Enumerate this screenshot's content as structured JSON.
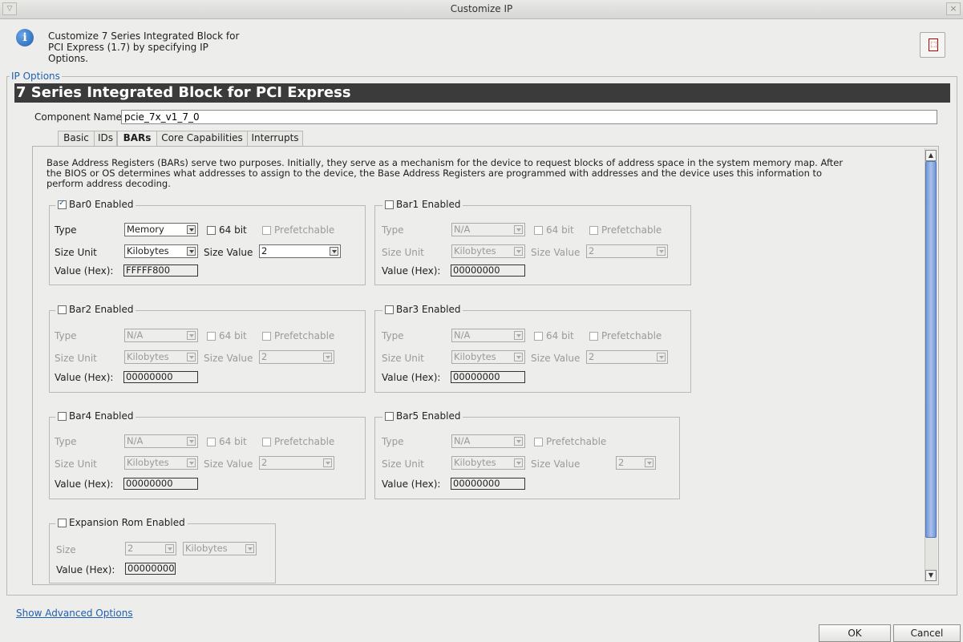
{
  "window": {
    "title": "Customize IP"
  },
  "header": {
    "description": "Customize 7 Series Integrated Block for\nPCI Express (1.7) by specifying IP\nOptions."
  },
  "ip_options": {
    "legend": "IP Options",
    "banner": "7 Series Integrated Block for PCI Express",
    "component_name_label": "Component Name",
    "component_name_value": "pcie_7x_v1_7_0"
  },
  "tabs": [
    "Basic",
    "IDs",
    "BARs",
    "Core Capabilities",
    "Interrupts"
  ],
  "active_tab": "BARs",
  "bars_description": "Base Address Registers (BARs) serve two purposes. Initially, they serve as a mechanism for the device to request blocks of address space in the system memory map. After the BIOS or OS determines what addresses to assign to the device, the Base Address Registers are programmed with addresses and the device uses this information to perform address decoding.",
  "labels": {
    "type": "Type",
    "size_unit": "Size Unit",
    "size_value": "Size Value",
    "value_hex": "Value (Hex):",
    "bit64": "64 bit",
    "prefetchable": "Prefetchable",
    "size": "Size"
  },
  "bars": [
    {
      "legend": "Bar0 Enabled",
      "enabled": true,
      "type": "Memory",
      "size_unit": "Kilobytes",
      "size_value": "2",
      "value_hex": "FFFFF800"
    },
    {
      "legend": "Bar1 Enabled",
      "enabled": false,
      "type": "N/A",
      "size_unit": "Kilobytes",
      "size_value": "2",
      "value_hex": "00000000"
    },
    {
      "legend": "Bar2 Enabled",
      "enabled": false,
      "type": "N/A",
      "size_unit": "Kilobytes",
      "size_value": "2",
      "value_hex": "00000000"
    },
    {
      "legend": "Bar3 Enabled",
      "enabled": false,
      "type": "N/A",
      "size_unit": "Kilobytes",
      "size_value": "2",
      "value_hex": "00000000"
    },
    {
      "legend": "Bar4 Enabled",
      "enabled": false,
      "type": "N/A",
      "size_unit": "Kilobytes",
      "size_value": "2",
      "value_hex": "00000000"
    },
    {
      "legend": "Bar5 Enabled",
      "enabled": false,
      "type": "N/A",
      "size_unit": "Kilobytes",
      "size_value": "2",
      "value_hex": "00000000"
    }
  ],
  "expansion_rom": {
    "legend": "Expansion Rom Enabled",
    "enabled": false,
    "size": "2",
    "unit": "Kilobytes",
    "value_hex": "00000000"
  },
  "footer": {
    "show_advanced": "Show Advanced Options",
    "ok": "OK",
    "cancel": "Cancel"
  },
  "colors": {
    "accent": "#2060b0",
    "banner_bg": "#3b3b3b",
    "scroll_thumb": "#6f95d6"
  }
}
